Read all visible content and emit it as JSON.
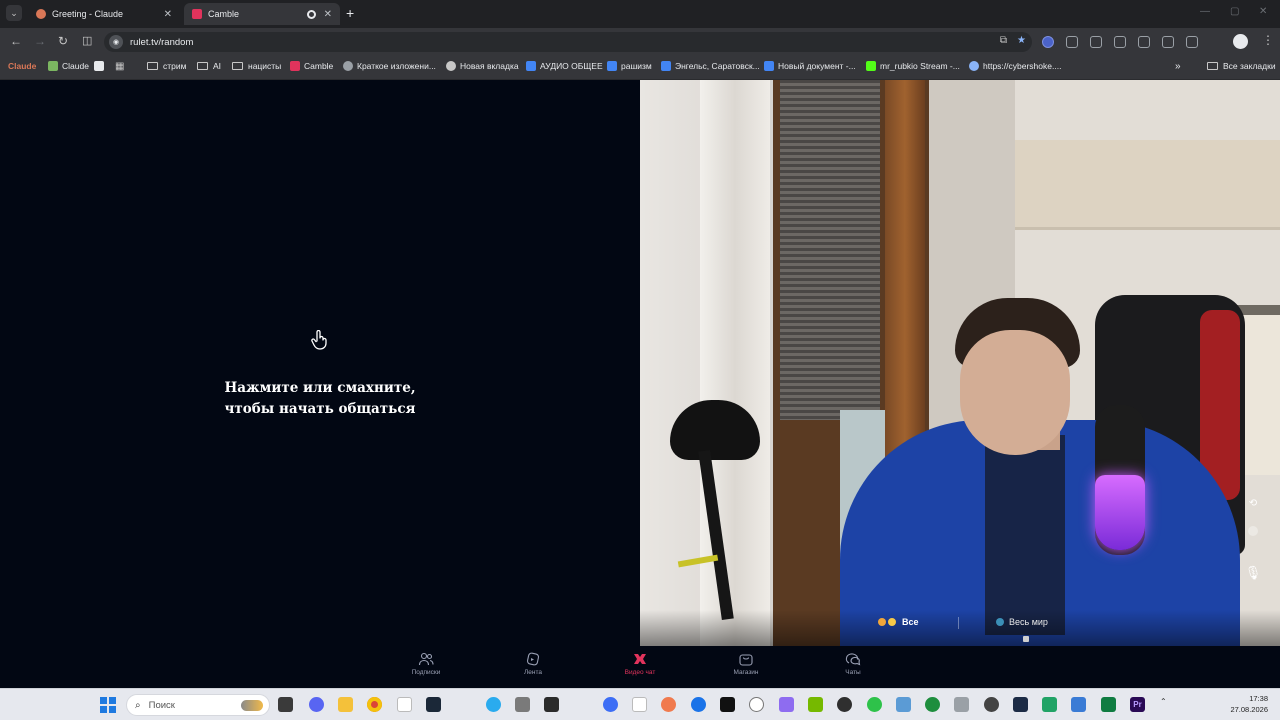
{
  "browser": {
    "tabs": [
      {
        "title": "Greeting - Claude",
        "favicon_color": "#d97757",
        "active": false
      },
      {
        "title": "Camble",
        "favicon_color": "#e1335c",
        "active": true
      }
    ],
    "url": "rulet.tv/random",
    "bookmarks": [
      {
        "label": "Claude",
        "kind": "logo",
        "color": "#d97757"
      },
      {
        "label": "Claude",
        "kind": "site",
        "color": "#7bb661"
      },
      {
        "label": "",
        "kind": "site",
        "color": "#e8eaed"
      },
      {
        "label": "",
        "kind": "apps",
        "color": "#c8c8c8"
      },
      {
        "label": "стрим",
        "kind": "folder"
      },
      {
        "label": "AI",
        "kind": "folder"
      },
      {
        "label": "нацисты",
        "kind": "folder"
      },
      {
        "label": "Camble",
        "kind": "site",
        "color": "#e1335c"
      },
      {
        "label": "Краткое изложени...",
        "kind": "site",
        "color": "#9aa0a6"
      },
      {
        "label": "Новая вкладка",
        "kind": "site",
        "color": "#c8c8c8"
      },
      {
        "label": "АУДИО ОБЩЕЕ",
        "kind": "site",
        "color": "#4285f4"
      },
      {
        "label": "рашизм",
        "kind": "site",
        "color": "#4285f4"
      },
      {
        "label": "Энгельс, Саратовск...",
        "kind": "site",
        "color": "#4285f4"
      },
      {
        "label": "Новый документ -...",
        "kind": "site",
        "color": "#4285f4"
      },
      {
        "label": "mr_rubkio Stream -...",
        "kind": "site",
        "color": "#53fc18"
      },
      {
        "label": "https://cybershoke....",
        "kind": "site",
        "color": "#8ab4f8"
      }
    ],
    "all_bookmarks": "Все закладки"
  },
  "app": {
    "prompt_line1": "Нажмите или смахните,",
    "prompt_line2": "чтобы начать общаться",
    "filters": {
      "all": "Все",
      "world": "Весь мир"
    },
    "nav": [
      {
        "label": "Подписки",
        "icon": "people-icon",
        "active": false
      },
      {
        "label": "Лента",
        "icon": "feed-icon",
        "active": false
      },
      {
        "label": "Видео чат",
        "icon": "video-chat-icon",
        "active": true
      },
      {
        "label": "Магазин",
        "icon": "shop-icon",
        "active": false
      },
      {
        "label": "Чаты",
        "icon": "chats-icon",
        "active": false
      }
    ],
    "accent": "#e1335c"
  },
  "taskbar": {
    "search_placeholder": "Поиск",
    "time": "17:38",
    "date": "27.08.2026"
  }
}
